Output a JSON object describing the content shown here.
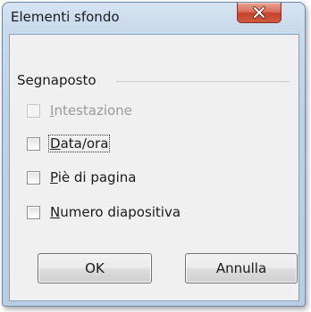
{
  "window": {
    "title": "Elementi sfondo"
  },
  "group": {
    "label": "Segnaposto"
  },
  "options": [
    {
      "label_key": "I",
      "label_rest": "ntestazione",
      "checked": false,
      "enabled": false
    },
    {
      "label_key": "D",
      "label_rest": "ata/ora",
      "checked": false,
      "enabled": true
    },
    {
      "label_key": "P",
      "label_rest": "iè di pagina",
      "checked": false,
      "enabled": true
    },
    {
      "label_key": "N",
      "label_rest": "umero diapositiva",
      "checked": false,
      "enabled": true
    }
  ],
  "buttons": {
    "ok": "OK",
    "cancel": "Annulla"
  },
  "colors": {
    "close_button": "#c4412a",
    "title_bar": "#bcd0e6",
    "client_background": "#f0f0f0"
  },
  "icons": {
    "close": "close-icon"
  }
}
